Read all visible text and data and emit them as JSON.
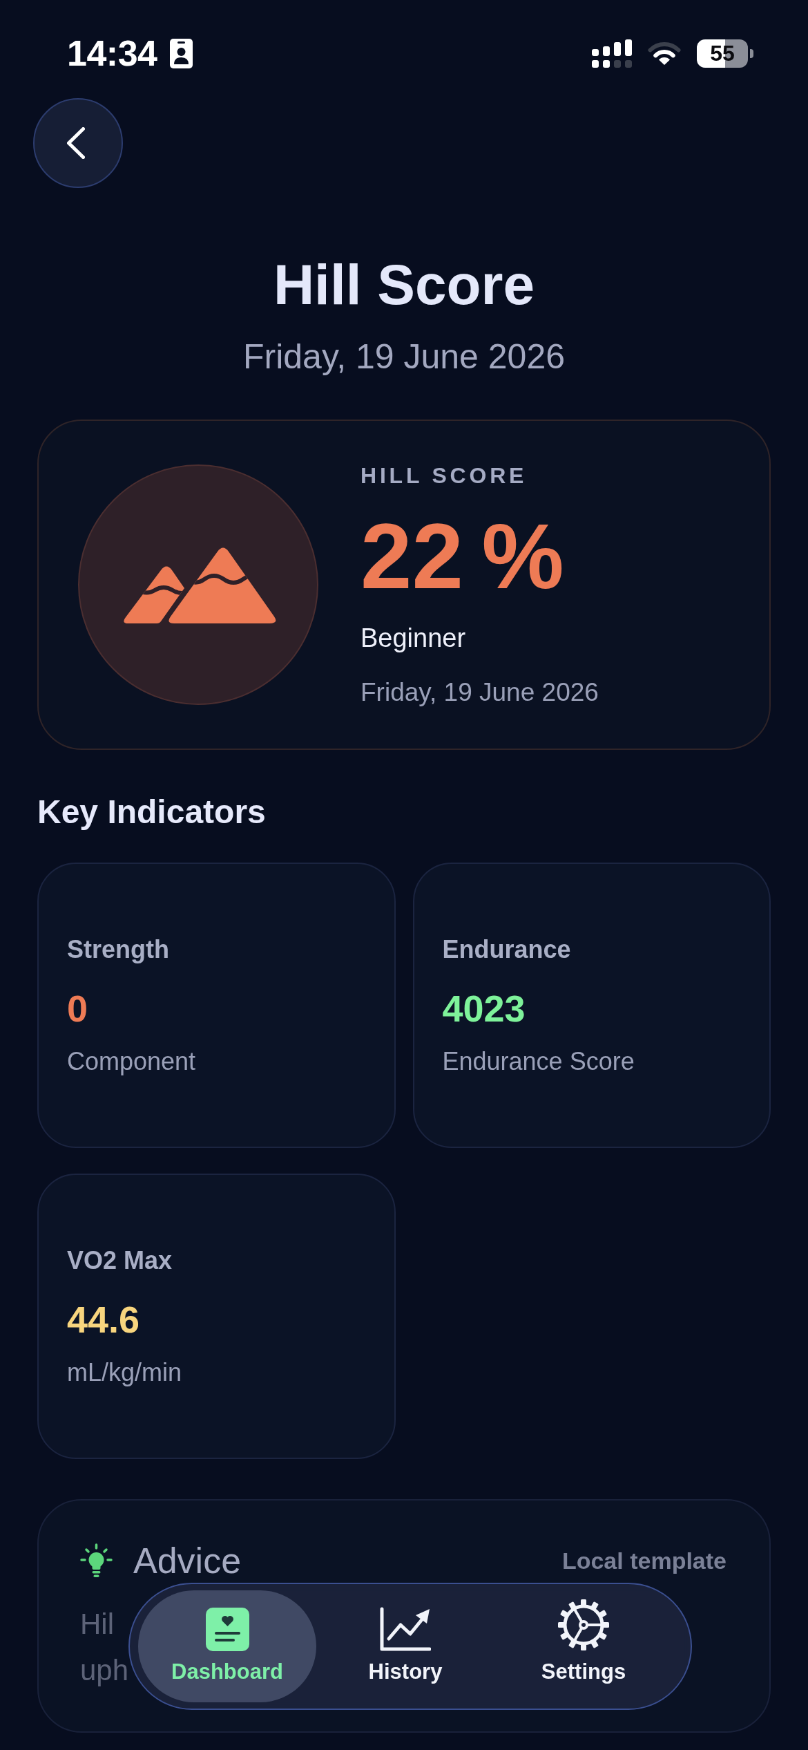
{
  "status_bar": {
    "time": "14:34",
    "battery": "55"
  },
  "header": {
    "title": "Hill Score",
    "date": "Friday, 19 June 2026"
  },
  "score_card": {
    "label": "HILL SCORE",
    "value": "22 %",
    "rank": "Beginner",
    "date": "Friday, 19 June 2026"
  },
  "key_indicators": {
    "title": "Key Indicators",
    "cards": [
      {
        "title": "Strength",
        "value": "0",
        "caption": "Component",
        "color": "#ee7b55"
      },
      {
        "title": "Endurance",
        "value": "4023",
        "caption": "Endurance Score",
        "color": "#7ef29a"
      },
      {
        "title": "VO2 Max",
        "value": "44.6",
        "caption": "mL/kg/min",
        "color": "#f8d57e"
      }
    ]
  },
  "advice": {
    "title": "Advice",
    "source": "Local template",
    "text_lines": [
      "Hil",
      "uph"
    ]
  },
  "tab_bar": {
    "tabs": [
      {
        "kind": "dashboard",
        "label": "Dashboard",
        "selected": true
      },
      {
        "kind": "history",
        "label": "History",
        "selected": false
      },
      {
        "kind": "settings",
        "label": "Settings",
        "selected": false
      }
    ]
  }
}
